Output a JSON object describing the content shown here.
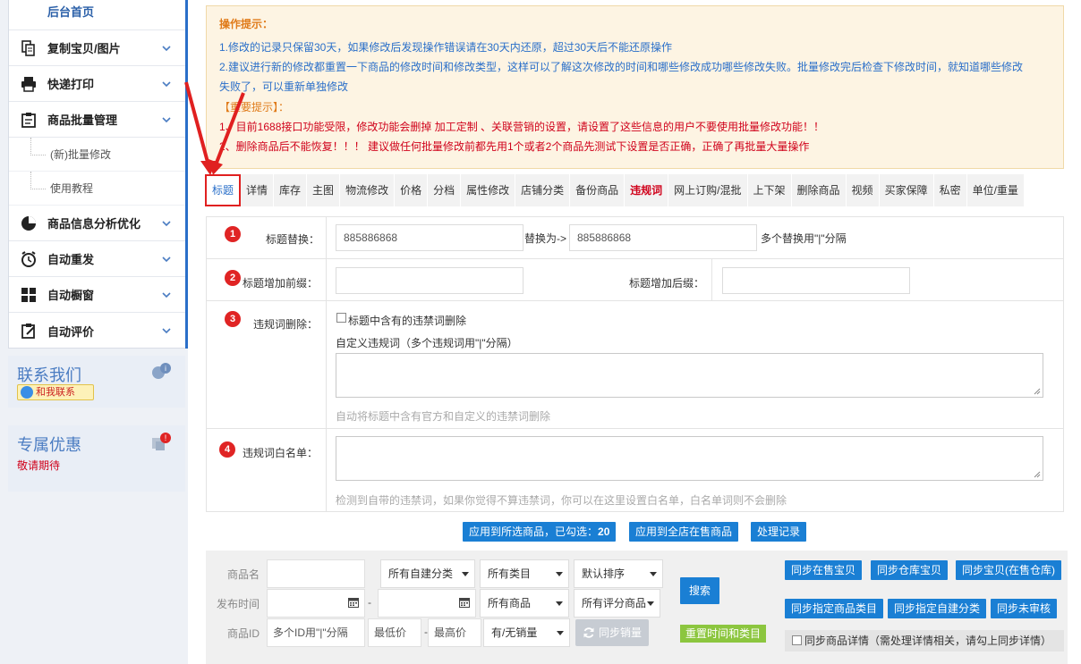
{
  "sidebar": {
    "home": "后台首页",
    "items": [
      {
        "label": "复制宝贝/图片",
        "icon": "copy-icon"
      },
      {
        "label": "快递打印",
        "icon": "printer-icon"
      },
      {
        "label": "商品批量管理",
        "icon": "clipboard-icon"
      }
    ],
    "sub_items": [
      "(新)批量修改",
      "使用教程"
    ],
    "items2": [
      {
        "label": "商品信息分析优化",
        "icon": "pie-chart-icon"
      },
      {
        "label": "自动重发",
        "icon": "alarm-clock-icon"
      },
      {
        "label": "自动橱窗",
        "icon": "grid-icon"
      },
      {
        "label": "自动评价",
        "icon": "clipboard-edit-icon"
      }
    ],
    "contact": {
      "title": "联系我们",
      "button": "和我联系"
    },
    "promo": {
      "title": "专属优惠",
      "subtitle": "敬请期待"
    }
  },
  "notice": {
    "title": "操作提示：",
    "line1": "1.修改的记录只保留30天，如果修改后发现操作错误请在30天内还原，超过30天后不能还原操作",
    "line2a": "2.建议进行新的修改都重置一下商品的修改时间和修改类型，这样可以了解这次修改的时间和哪些修改成功哪些修改失败。批量修改完后检查下修改时间，就知道哪些修改",
    "line2b": "失败了，可以重新单独修改",
    "important": "【重要提示】：",
    "red1": "1、目前1688接口功能受限，修改功能会删掉 加工定制 、关联营销的设置，请设置了这些信息的用户不要使用批量修改功能！！",
    "red2": "2、删除商品后不能恢复！！！ 建议做任何批量修改前都先用1个或者2个商品先测试下设置是否正确，正确了再批量大量操作"
  },
  "tabs": [
    {
      "label": "标题",
      "state": "active"
    },
    {
      "label": "详情"
    },
    {
      "label": "库存"
    },
    {
      "label": "主图"
    },
    {
      "label": "物流修改"
    },
    {
      "label": "价格"
    },
    {
      "label": "分档"
    },
    {
      "label": "属性修改"
    },
    {
      "label": "店铺分类"
    },
    {
      "label": "备份商品"
    },
    {
      "label": "违规词",
      "state": "highlight"
    },
    {
      "label": "网上订购/混批"
    },
    {
      "label": "上下架"
    },
    {
      "label": "删除商品"
    },
    {
      "label": "视频"
    },
    {
      "label": "买家保障"
    },
    {
      "label": "私密"
    },
    {
      "label": "单位/重量"
    }
  ],
  "form": {
    "replace": {
      "num": "1",
      "label": "标题替换：",
      "from_value": "885886868",
      "mid": "替换为->",
      "to_value": "885886868",
      "note": "多个替换用\"|\"分隔"
    },
    "affix": {
      "num": "2",
      "prefix_label": "标题增加前缀：",
      "suffix_label": "标题增加后缀："
    },
    "banned": {
      "num": "3",
      "label": "违规词删除：",
      "checkbox_label": "标题中含有的违禁词删除",
      "custom_label": "自定义违规词（多个违规词用\"|\"分隔）",
      "hint": "自动将标题中含有官方和自定义的违禁词删除"
    },
    "whitelist": {
      "num": "4",
      "label": "违规词白名单：",
      "hint": "检测到自带的违禁词，如果你觉得不算违禁词，你可以在这里设置白名单，白名单词则不会删除"
    }
  },
  "actions": {
    "apply_selected": "应用到所选商品，已勾选：",
    "selected_count": "20",
    "apply_all": "应用到全店在售商品",
    "records": "处理记录"
  },
  "filter": {
    "product_name_label": "商品名",
    "publish_time_label": "发布时间",
    "product_id_label": "商品ID",
    "date_sep": "-",
    "price_sep": "-",
    "id_placeholder": "多个ID用\"|\"分隔",
    "min_price": "最低价",
    "max_price": "最高价",
    "category_custom": "所有自建分类",
    "category_all": "所有类目",
    "sort": "默认排序",
    "product_all": "所有商品",
    "rating_all": "所有评分商品",
    "sales": "有/无销量",
    "search": "搜索",
    "sync_sales": "同步销量",
    "reset": "重置时间和类目",
    "sync_onsale": "同步在售宝贝",
    "sync_warehouse": "同步仓库宝贝",
    "sync_both": "同步宝贝(在售仓库)",
    "sync_category": "同步指定商品类目",
    "sync_custom_category": "同步指定自建分类",
    "sync_unreviewed": "同步未审核",
    "sync_detail": "同步商品详情（需处理详情相关，请勾上同步详情）"
  },
  "colors": {
    "accent": "#2a6fc9",
    "danger": "#e02020",
    "button_blue": "#1a7fd4",
    "notice_bg": "#fdf4e3"
  }
}
